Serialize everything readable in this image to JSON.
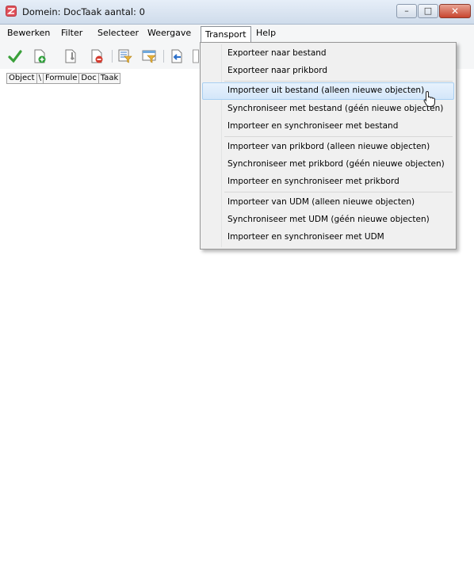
{
  "window": {
    "title": "Domein: DocTaak aantal: 0",
    "controls": {
      "minimize": "–",
      "maximize": "□",
      "close": "✕"
    }
  },
  "menubar": {
    "items": [
      {
        "label": "Bewerken"
      },
      {
        "label": "Filter"
      },
      {
        "label": "Selecteer"
      },
      {
        "label": "Weergave"
      },
      {
        "label": "Transport"
      },
      {
        "label": "Help"
      }
    ],
    "open_menu": "Transport"
  },
  "toolbar": {
    "icons": [
      {
        "name": "checkmark-icon",
        "color": "#3aa03a"
      },
      {
        "name": "new-document-icon",
        "color": "#2e9e3a"
      },
      {
        "name": "document-settings-icon",
        "color": "#777777"
      },
      {
        "name": "delete-document-icon",
        "color": "#d43b2f"
      },
      {
        "name": "filter-icon",
        "color": "#e8b33a"
      },
      {
        "name": "filter-list-icon",
        "color": "#e8b33a"
      },
      {
        "name": "import-arrow-icon",
        "color": "#2b6fc9"
      }
    ]
  },
  "columns": [
    "Object",
    "\\",
    "Formule",
    "Doc",
    "Taak"
  ],
  "dropdown": {
    "groups": [
      [
        {
          "label": "Exporteer naar bestand"
        },
        {
          "label": "Exporteer naar prikbord"
        }
      ],
      [
        {
          "label": "Importeer uit bestand (alleen nieuwe objecten)",
          "highlighted": true
        },
        {
          "label": "Synchroniseer met bestand (géén nieuwe objecten)"
        },
        {
          "label": "Importeer en synchroniseer met bestand"
        }
      ],
      [
        {
          "label": "Importeer van prikbord (alleen nieuwe objecten)"
        },
        {
          "label": "Synchroniseer met prikbord (géén nieuwe objecten)"
        },
        {
          "label": "Importeer en synchroniseer met prikbord"
        }
      ],
      [
        {
          "label": "Importeer van UDM (alleen nieuwe objecten)"
        },
        {
          "label": "Synchroniseer met UDM (géén nieuwe objecten)"
        },
        {
          "label": "Importeer en synchroniseer met UDM"
        }
      ]
    ]
  }
}
